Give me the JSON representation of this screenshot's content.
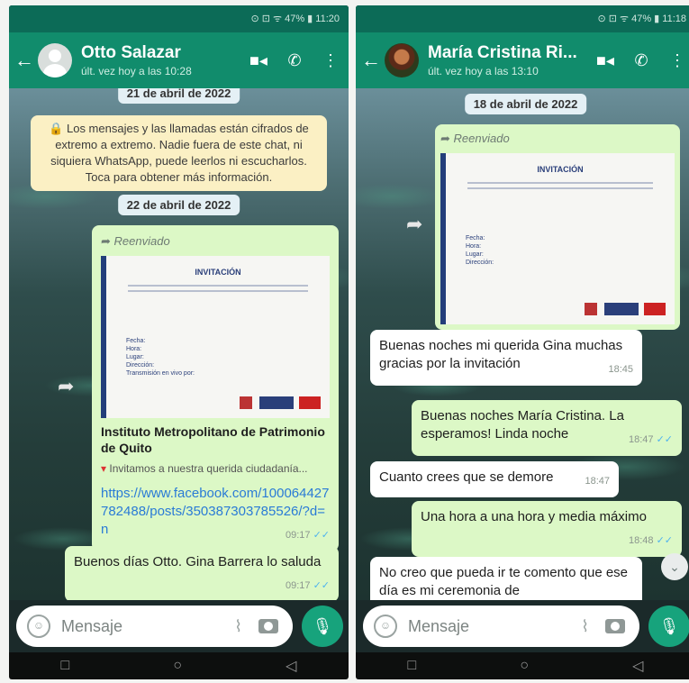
{
  "left": {
    "status": "⊙ ⊡ ᯤ 47% ▮ 11:20",
    "contact_name": "Otto Salazar",
    "contact_status": "últ. vez hoy a las 10:28",
    "date_pill_top": "21 de abril de 2022",
    "encryption_notice": "🔒 Los mensajes y las llamadas están cifrados de extremo a extremo. Nadie fuera de este chat, ni siquiera WhatsApp, puede leerlos ni escucharlos. Toca para obtener más información.",
    "date_pill": "22 de abril de 2022",
    "forwarded_label": "Reenviado",
    "flyer": {
      "title": "INVITACIÓN",
      "fields": [
        "Fecha:",
        "Hora:",
        "Lugar:",
        "Dirección:",
        "Transmisión en vivo por:"
      ]
    },
    "link_title": "Instituto Metropolitano de Patrimonio de Quito",
    "link_desc": "Invitamos a nuestra querida ciudadanía...",
    "link_url": "https://www.facebook.com/100064427782488/posts/350387303785526/?d=n",
    "link_time": "09:17",
    "greeting_text": "Buenos días Otto. Gina Barrera lo saluda",
    "greeting_time": "09:17",
    "input_placeholder": "Mensaje"
  },
  "right": {
    "status": "⊙ ⊡ ᯤ 47% ▮ 11:18",
    "contact_name": "María Cristina Ri...",
    "contact_status": "últ. vez hoy a las 13:10",
    "date_pill": "18 de abril de 2022",
    "forwarded_label": "Reenviado",
    "flyer": {
      "title": "INVITACIÓN",
      "fields": [
        "Fecha:",
        "Hora:",
        "Lugar:",
        "Dirección:"
      ]
    },
    "messages": [
      {
        "dir": "in",
        "text": "Buenas noches mi querida Gina muchas gracias por la invitación",
        "time": "18:45"
      },
      {
        "dir": "out",
        "text": "Buenas noches María Cristina. La esperamos! Linda noche",
        "time": "18:47"
      },
      {
        "dir": "in",
        "text": "Cuanto crees que se demore",
        "time": "18:47"
      },
      {
        "dir": "out",
        "text": "Una hora a una hora y media máximo",
        "time": "18:48"
      },
      {
        "dir": "in",
        "text": "No creo que pueda ir te comento que ese día es mi ceremonia de",
        "time": ""
      }
    ],
    "input_placeholder": "Mensaje"
  },
  "icons": {
    "back": "back-arrow-icon",
    "video": "video-call-icon",
    "call": "phone-call-icon",
    "menu": "more-vert-icon",
    "emoji": "emoji-icon",
    "attach": "paperclip-icon",
    "camera": "camera-icon",
    "mic": "microphone-icon",
    "share": "share-icon",
    "scroll": "scroll-down-icon"
  },
  "colors": {
    "header": "#118c6c",
    "outgoing": "#dcf8c6",
    "incoming": "#ffffff",
    "ticks": "#4fb3ee"
  }
}
